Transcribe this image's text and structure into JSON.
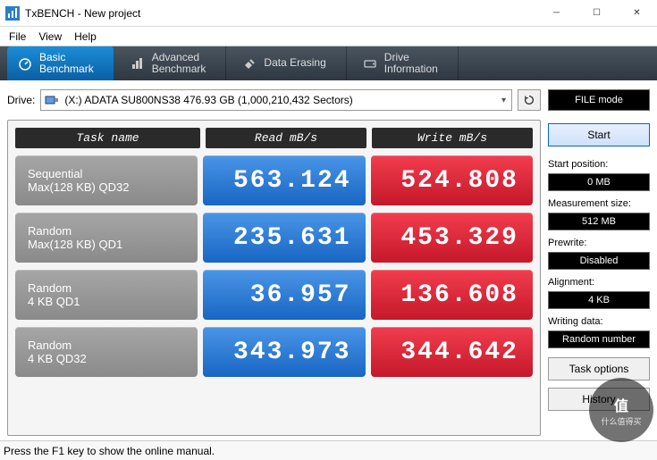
{
  "window": {
    "title": "TxBENCH - New project"
  },
  "menu": [
    "File",
    "View",
    "Help"
  ],
  "tabs": [
    {
      "label": "Basic\nBenchmark",
      "active": true
    },
    {
      "label": "Advanced\nBenchmark",
      "active": false
    },
    {
      "label": "Data Erasing",
      "active": false
    },
    {
      "label": "Drive\nInformation",
      "active": false
    }
  ],
  "drive": {
    "label": "Drive:",
    "value": "(X:) ADATA SU800NS38  476.93 GB (1,000,210,432 Sectors)"
  },
  "bench": {
    "headers": {
      "task": "Task name",
      "read": "Read mB/s",
      "write": "Write mB/s"
    },
    "rows": [
      {
        "name1": "Sequential",
        "name2": "Max(128 KB) QD32",
        "read": "563.124",
        "write": "524.808"
      },
      {
        "name1": "Random",
        "name2": "Max(128 KB) QD1",
        "read": "235.631",
        "write": "453.329"
      },
      {
        "name1": "Random",
        "name2": "4 KB QD1",
        "read": "36.957",
        "write": "136.608"
      },
      {
        "name1": "Random",
        "name2": "4 KB QD32",
        "read": "343.973",
        "write": "344.642"
      }
    ]
  },
  "side": {
    "mode": "FILE mode",
    "start": "Start",
    "settings": [
      {
        "label": "Start position:",
        "value": "0 MB"
      },
      {
        "label": "Measurement size:",
        "value": "512 MB"
      },
      {
        "label": "Prewrite:",
        "value": "Disabled"
      },
      {
        "label": "Alignment:",
        "value": "4 KB"
      },
      {
        "label": "Writing data:",
        "value": "Random number"
      }
    ],
    "task_options": "Task options",
    "history": "History"
  },
  "status": "Press the F1 key to show the online manual.",
  "watermark": {
    "big": "值",
    "small": "什么值得买"
  }
}
